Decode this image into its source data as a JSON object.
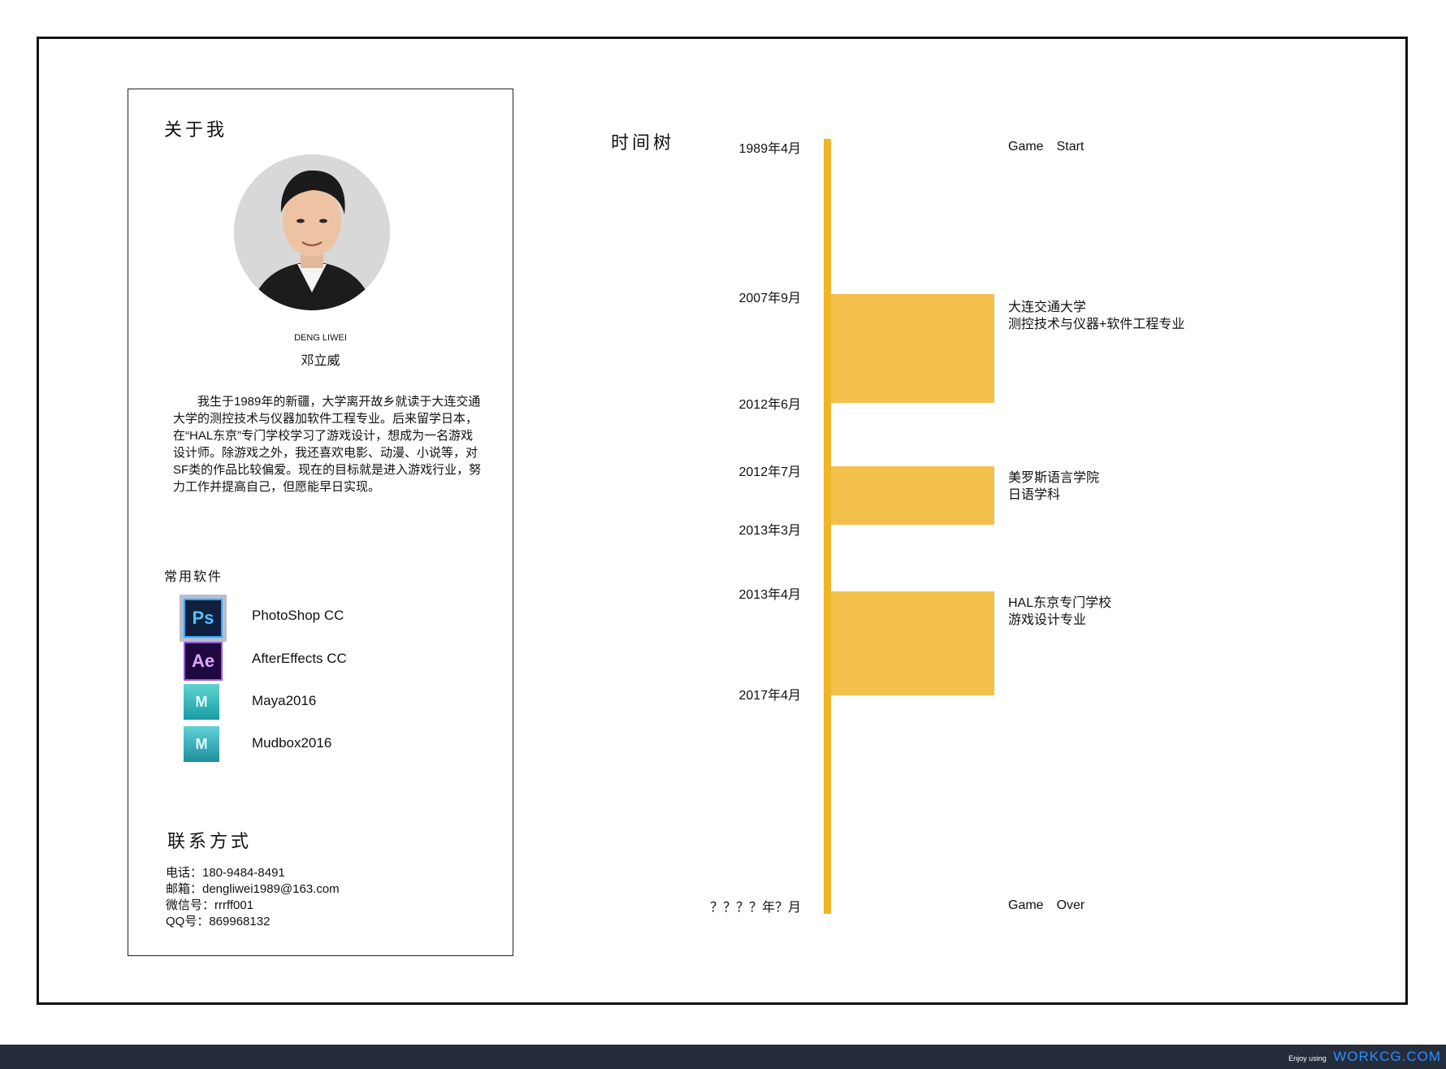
{
  "about": {
    "title": "关于我",
    "name_en": "DENG LIWEI",
    "name_cn": "邓立威",
    "bio": "我生于1989年的新疆，大学离开故乡就读于大连交通大学的测控技术与仪器加软件工程专业。后来留学日本，在“HAL东京”专门学校学习了游戏设计，想成为一名游戏设计师。除游戏之外，我还喜欢电影、动漫、小说等，对SF类的作品比较偏爱。现在的目标就是进入游戏行业，努力工作并提高自己，但愿能早日实现。"
  },
  "software": {
    "title": "常用软件",
    "items": [
      {
        "icon": "photoshop-icon",
        "icon_text": "Ps",
        "label": "PhotoShop CC"
      },
      {
        "icon": "after-effects-icon",
        "icon_text": "Ae",
        "label": "AfterEffects CC"
      },
      {
        "icon": "maya-icon",
        "icon_text": "M",
        "label": "Maya2016"
      },
      {
        "icon": "mudbox-icon",
        "icon_text": "M",
        "label": "Mudbox2016"
      }
    ]
  },
  "contact": {
    "title": "联系方式",
    "phone": "电话：180-9484-8491",
    "email": "邮箱：dengliwei1989@163.com",
    "wechat": "微信号：rrrff001",
    "qq": "QQ号：869968132"
  },
  "timeline": {
    "title": "时间树",
    "dates": [
      "1989年4月",
      "2007年9月",
      "2012年6月",
      "2012年7月",
      "2013年3月",
      "2013年4月",
      "2017年4月",
      "？？？？年？月"
    ],
    "events": [
      {
        "line1": "Game　Start",
        "line2": ""
      },
      {
        "line1": "大连交通大学",
        "line2": "测控技术与仪器+软件工程专业"
      },
      {
        "line1": "美罗斯语言学院",
        "line2": "日语学科"
      },
      {
        "line1": "HAL东京专门学校",
        "line2": "游戏设计专业"
      },
      {
        "line1": "Game　Over",
        "line2": ""
      }
    ],
    "colors": {
      "axis": "#f0b429",
      "bar": "#f2c04b"
    }
  },
  "footer": {
    "prefix": "Enjoy using",
    "brand": "WORKCG.COM"
  }
}
